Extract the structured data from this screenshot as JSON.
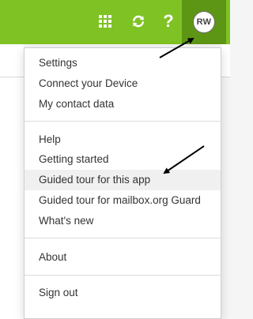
{
  "colors": {
    "accent": "#7fc224",
    "active": "#5d9614",
    "menu_text": "#333333",
    "arrow": "#000000"
  },
  "topbar": {
    "apps_icon": "apps-grid-icon",
    "refresh_icon": "refresh-icon",
    "help_icon": "help-icon",
    "help_glyph": "?",
    "avatar_initials": "RW"
  },
  "menu": {
    "groups": [
      [
        "Settings",
        "Connect your Device",
        "My contact data"
      ],
      [
        "Help",
        "Getting started",
        "Guided tour for this app",
        "Guided tour for mailbox.org Guard",
        "What's new"
      ],
      [
        "About"
      ],
      [
        "Sign out"
      ]
    ],
    "highlighted_item": "Guided tour for this app"
  }
}
